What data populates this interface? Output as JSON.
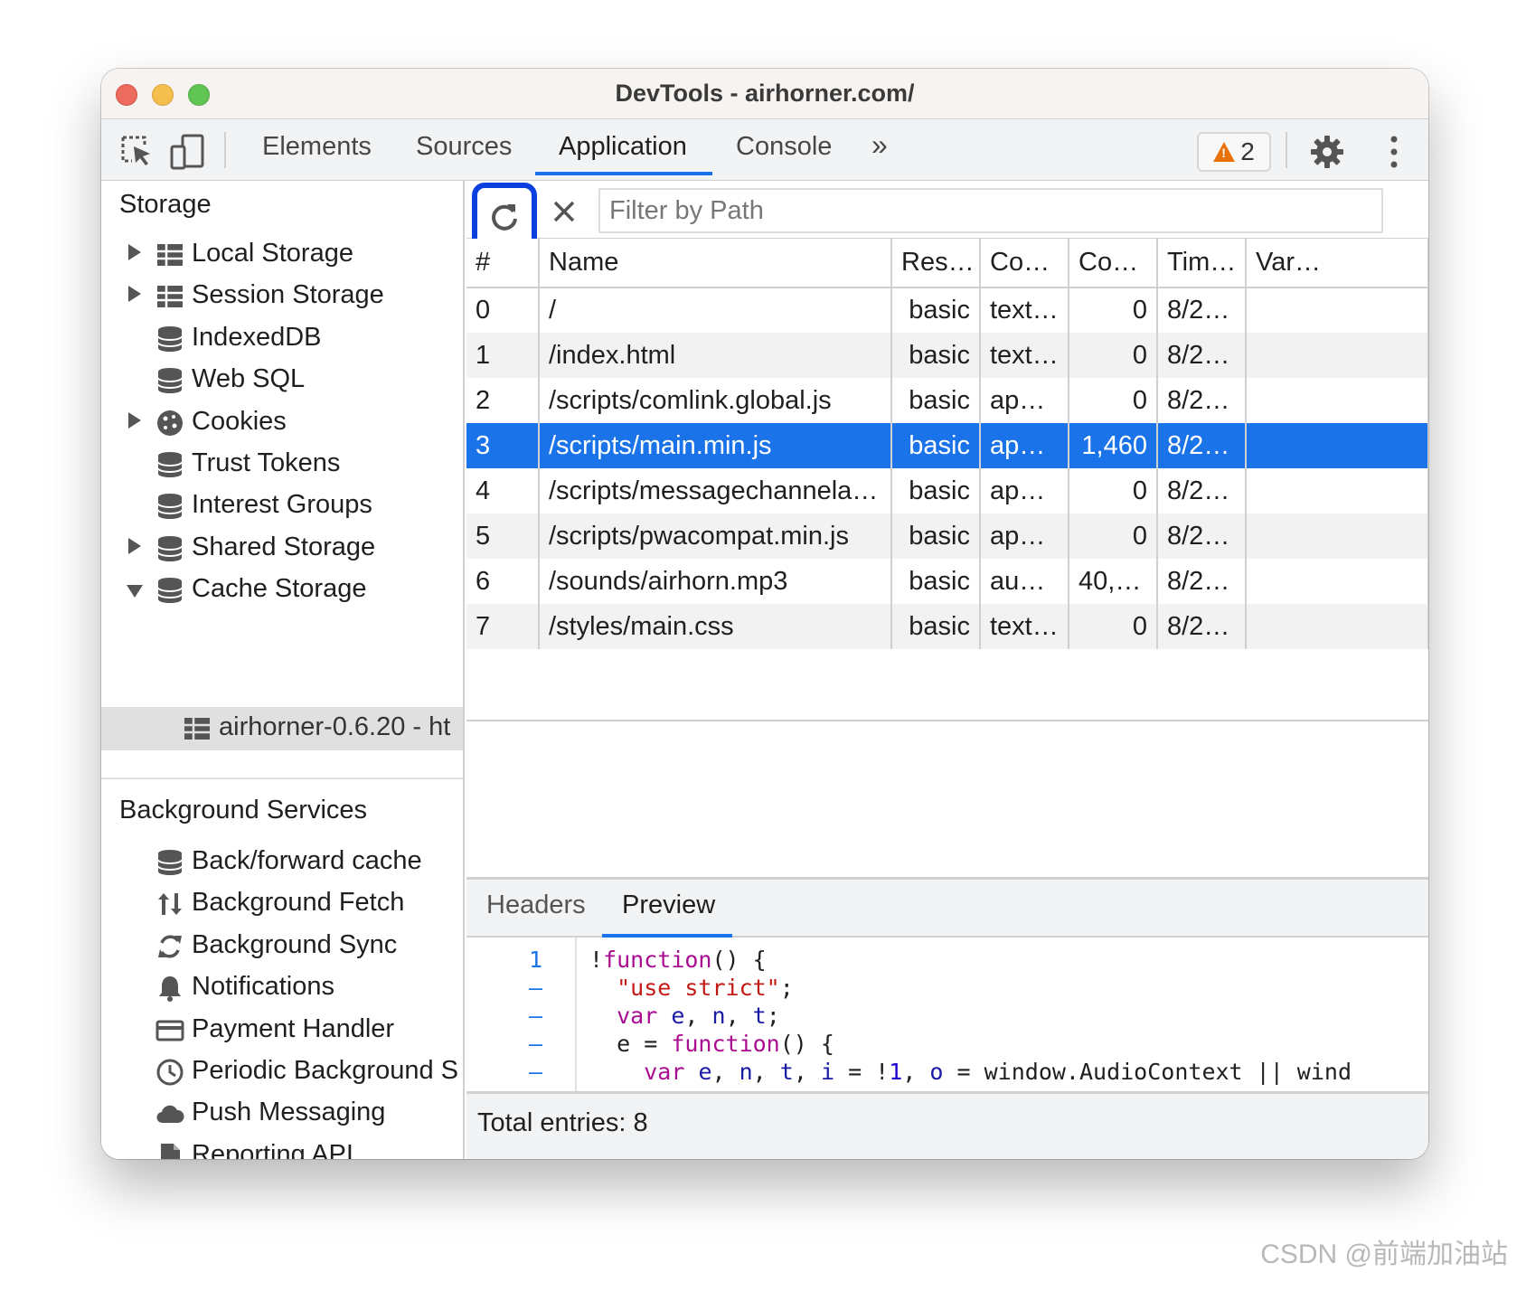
{
  "window": {
    "title": "DevTools - airhorner.com/"
  },
  "toolbar": {
    "tabs": [
      {
        "label": "Elements"
      },
      {
        "label": "Sources"
      },
      {
        "label": "Application"
      },
      {
        "label": "Console"
      }
    ],
    "more_tabs": "»",
    "warning_count": "2",
    "accent": "#1a73e8"
  },
  "sidebar": {
    "storage_heading": "Storage",
    "storage_items": [
      {
        "label": "Local Storage",
        "icon": "table-icon",
        "expandable": "collapsed"
      },
      {
        "label": "Session Storage",
        "icon": "table-icon",
        "expandable": "collapsed"
      },
      {
        "label": "IndexedDB",
        "icon": "database-icon"
      },
      {
        "label": "Web SQL",
        "icon": "database-icon"
      },
      {
        "label": "Cookies",
        "icon": "cookie-icon",
        "expandable": "collapsed"
      },
      {
        "label": "Trust Tokens",
        "icon": "database-icon"
      },
      {
        "label": "Interest Groups",
        "icon": "database-icon"
      },
      {
        "label": "Shared Storage",
        "icon": "database-icon",
        "expandable": "collapsed"
      },
      {
        "label": "Cache Storage",
        "icon": "database-icon",
        "expandable": "expanded"
      }
    ],
    "cache_child": {
      "label": "airhorner-0.6.20 - ht",
      "icon": "table-icon"
    },
    "background_heading": "Background Services",
    "background_items": [
      {
        "label": "Back/forward cache",
        "icon": "database-icon"
      },
      {
        "label": "Background Fetch",
        "icon": "up-down-arrows-icon"
      },
      {
        "label": "Background Sync",
        "icon": "sync-icon"
      },
      {
        "label": "Notifications",
        "icon": "bell-icon"
      },
      {
        "label": "Payment Handler",
        "icon": "credit-card-icon"
      },
      {
        "label": "Periodic Background S",
        "icon": "clock-icon"
      },
      {
        "label": "Push Messaging",
        "icon": "cloud-icon"
      },
      {
        "label": "Reporting API",
        "icon": "file-icon"
      }
    ]
  },
  "filter": {
    "placeholder": "Filter by Path"
  },
  "table": {
    "columns": [
      "#",
      "Name",
      "Res…",
      "Co…",
      "Co…",
      "Tim…",
      "Var…"
    ],
    "rows": [
      {
        "idx": "0",
        "name": "/",
        "res": "basic",
        "ctype": "text…",
        "clen": "0",
        "time": "8/2…",
        "vary": ""
      },
      {
        "idx": "1",
        "name": "/index.html",
        "res": "basic",
        "ctype": "text…",
        "clen": "0",
        "time": "8/2…",
        "vary": ""
      },
      {
        "idx": "2",
        "name": "/scripts/comlink.global.js",
        "res": "basic",
        "ctype": "app…",
        "clen": "0",
        "time": "8/2…",
        "vary": ""
      },
      {
        "idx": "3",
        "name": "/scripts/main.min.js",
        "res": "basic",
        "ctype": "app…",
        "clen": "1,460",
        "time": "8/2…",
        "vary": "",
        "selected": true
      },
      {
        "idx": "4",
        "name": "/scripts/messagechannela…",
        "res": "basic",
        "ctype": "app…",
        "clen": "0",
        "time": "8/2…",
        "vary": ""
      },
      {
        "idx": "5",
        "name": "/scripts/pwacompat.min.js",
        "res": "basic",
        "ctype": "app…",
        "clen": "0",
        "time": "8/2…",
        "vary": ""
      },
      {
        "idx": "6",
        "name": "/sounds/airhorn.mp3",
        "res": "basic",
        "ctype": "aud…",
        "clen": "40,…",
        "time": "8/2…",
        "vary": ""
      },
      {
        "idx": "7",
        "name": "/styles/main.css",
        "res": "basic",
        "ctype": "text…",
        "clen": "0",
        "time": "8/2…",
        "vary": ""
      }
    ]
  },
  "preview": {
    "tabs": [
      {
        "label": "Headers"
      },
      {
        "label": "Preview"
      }
    ],
    "gutter": [
      "1",
      "–",
      "–",
      "–",
      "–"
    ],
    "code": [
      [
        {
          "t": "!",
          "c": ""
        },
        {
          "t": "function",
          "c": "kw"
        },
        {
          "t": "() {",
          "c": ""
        }
      ],
      [
        {
          "t": "  ",
          "c": ""
        },
        {
          "t": "\"use strict\"",
          "c": "str"
        },
        {
          "t": ";",
          "c": ""
        }
      ],
      [
        {
          "t": "  ",
          "c": ""
        },
        {
          "t": "var",
          "c": "kw"
        },
        {
          "t": " ",
          "c": ""
        },
        {
          "t": "e",
          "c": "var"
        },
        {
          "t": ", ",
          "c": ""
        },
        {
          "t": "n",
          "c": "var"
        },
        {
          "t": ", ",
          "c": ""
        },
        {
          "t": "t",
          "c": "var"
        },
        {
          "t": ";",
          "c": ""
        }
      ],
      [
        {
          "t": "  e = ",
          "c": ""
        },
        {
          "t": "function",
          "c": "kw"
        },
        {
          "t": "() {",
          "c": ""
        }
      ],
      [
        {
          "t": "    ",
          "c": ""
        },
        {
          "t": "var",
          "c": "kw"
        },
        {
          "t": " ",
          "c": ""
        },
        {
          "t": "e",
          "c": "var"
        },
        {
          "t": ", ",
          "c": ""
        },
        {
          "t": "n",
          "c": "var"
        },
        {
          "t": ", ",
          "c": ""
        },
        {
          "t": "t",
          "c": "var"
        },
        {
          "t": ", ",
          "c": ""
        },
        {
          "t": "i",
          "c": "var"
        },
        {
          "t": " = !",
          "c": ""
        },
        {
          "t": "1",
          "c": "numc"
        },
        {
          "t": ", ",
          "c": ""
        },
        {
          "t": "o",
          "c": "var"
        },
        {
          "t": " = window.AudioContext || wind",
          "c": ""
        }
      ]
    ],
    "pretty_print": "{}"
  },
  "status": {
    "total": "Total entries: 8"
  },
  "watermark": "CSDN @前端加油站"
}
